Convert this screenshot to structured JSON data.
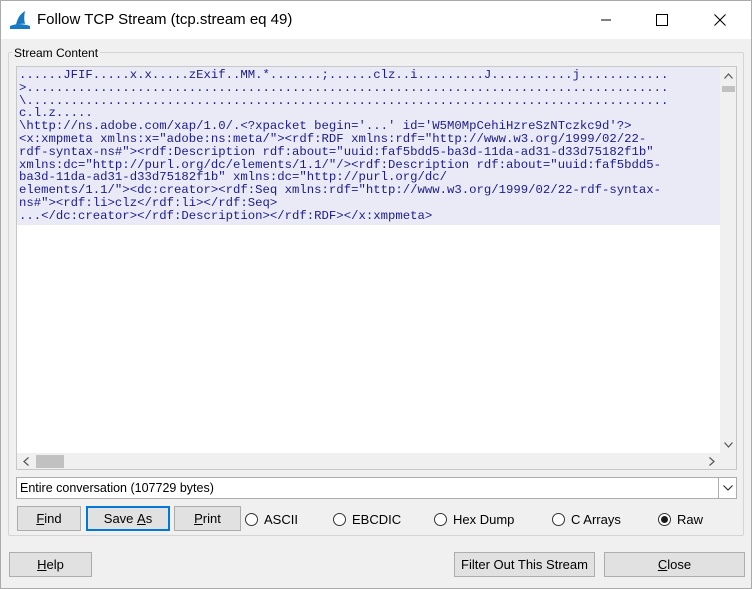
{
  "window": {
    "title": "Follow TCP Stream (tcp.stream eq 49)",
    "controls": [
      "minimize-icon",
      "maximize-icon",
      "close-icon"
    ]
  },
  "stream_group": {
    "label": "Stream Content",
    "lines": [
      "......JFIF.....x.x.....zExif..MM.*.......;......clz..i.........J...........j............",
      ">.......................................................................................",
      "\\.......................................................................................",
      "c.l.z.....",
      "\\http://ns.adobe.com/xap/1.0/.<?xpacket begin='...' id='W5M0MpCehiHzreSzNTczkc9d'?>",
      "<x:xmpmeta xmlns:x=\"adobe:ns:meta/\"><rdf:RDF xmlns:rdf=\"http://www.w3.org/1999/02/22-",
      "rdf-syntax-ns#\"><rdf:Description rdf:about=\"uuid:faf5bdd5-ba3d-11da-ad31-d33d75182f1b\"",
      "xmlns:dc=\"http://purl.org/dc/elements/1.1/\"/><rdf:Description rdf:about=\"uuid:faf5bdd5-",
      "ba3d-11da-ad31-d33d75182f1b\" xmlns:dc=\"http://purl.org/dc/",
      "elements/1.1/\"><dc:creator><rdf:Seq xmlns:rdf=\"http://www.w3.org/1999/02/22-rdf-syntax-",
      "ns#\"><rdf:li>clz</rdf:li></rdf:Seq>",
      "...</dc:creator></rdf:Description></rdf:RDF></x:xmpmeta>"
    ]
  },
  "conversation_select": {
    "value": "Entire conversation (107729 bytes)"
  },
  "buttons": {
    "find_u": "F",
    "find_rest": "ind",
    "save_pre": "Save ",
    "save_u": "A",
    "save_rest": "s",
    "print_u": "P",
    "print_rest": "rint",
    "help_u": "H",
    "help_rest": "elp",
    "filter_out": "Filter Out This Stream",
    "close_u": "C",
    "close_rest": "lose"
  },
  "format_options": {
    "selected": "Raw",
    "ascii": "ASCII",
    "ebcdic": "EBCDIC",
    "hexdump": "Hex Dump",
    "carrays": "C Arrays",
    "raw": "Raw"
  },
  "colors": {
    "stream_text": "#1c1c8c",
    "stream_bg": "#eaeaf6",
    "default_button_border": "#0078d7"
  }
}
